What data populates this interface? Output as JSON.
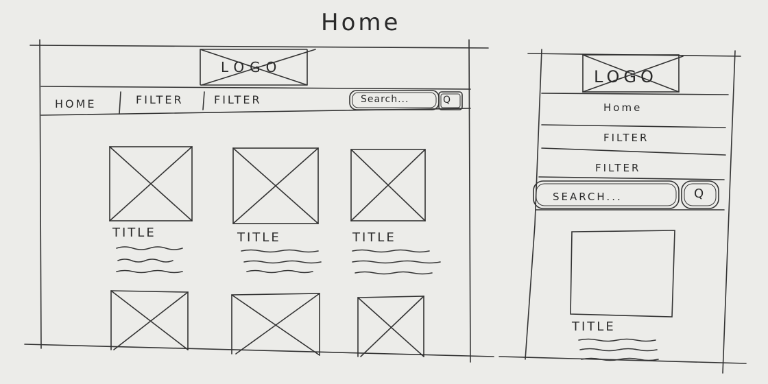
{
  "page_title": "Home",
  "desktop": {
    "logo": "LOGO",
    "nav": {
      "home": "HOME",
      "filter_1": "FILTER",
      "filter_2": "FILTER"
    },
    "search_placeholder": "Search...",
    "search_button": "Q",
    "cards": [
      {
        "title": "TITLE"
      },
      {
        "title": "TITLE"
      },
      {
        "title": "TITLE"
      }
    ]
  },
  "mobile": {
    "logo": "LOGO",
    "menu": {
      "home": "Home",
      "filter_1": "FILTER",
      "filter_2": "FILTER"
    },
    "search_placeholder": "SEARCH...",
    "search_button": "Q",
    "card": {
      "title": "TITLE"
    }
  }
}
